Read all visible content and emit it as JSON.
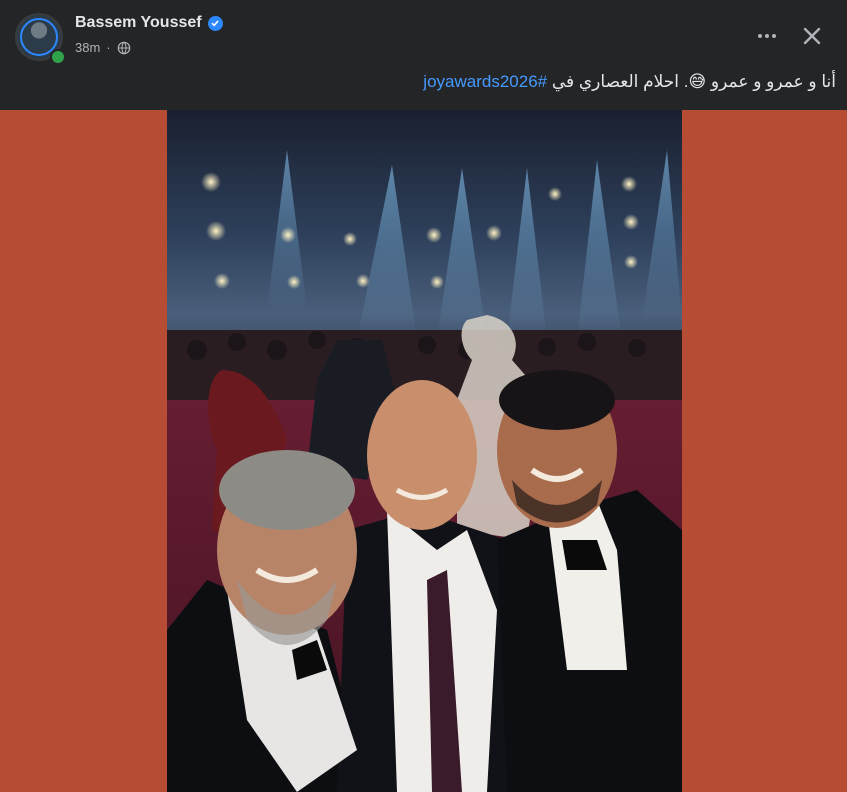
{
  "post": {
    "author": "Bassem Youssef",
    "time": "38m",
    "caption_text": "أنا و عمرو و عمرو 😅. احلام العصاري في ",
    "hashtag": "#joyawards2026"
  },
  "colors": {
    "background": "#242526",
    "accent": "#2d88ff",
    "photo_background": "#b54c33",
    "hashtag": "#4599ff"
  },
  "icons": {
    "verified": "verified-badge-icon",
    "audience": "globe-icon",
    "more": "more-options-icon",
    "close": "close-icon"
  }
}
